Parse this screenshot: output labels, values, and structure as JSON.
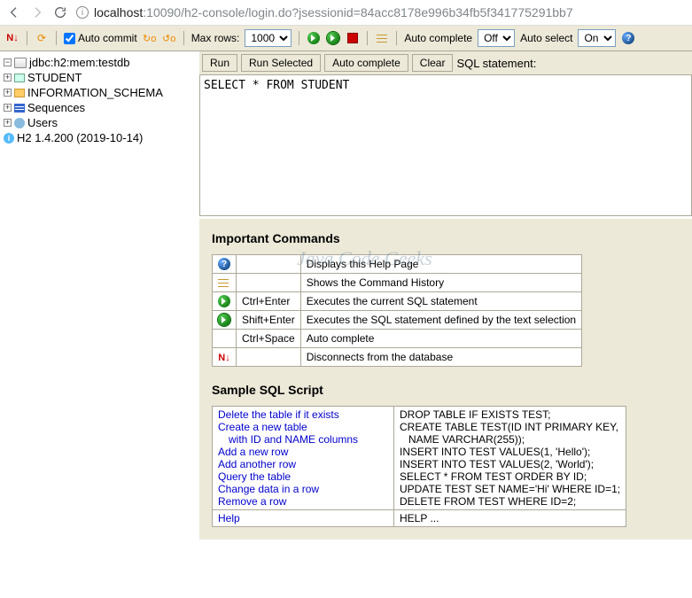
{
  "browser": {
    "url_host": "localhost",
    "url_rest": ":10090/h2-console/login.do?jsessionid=84acc8178e996b34fb5f341775291bb7"
  },
  "toolbar": {
    "auto_commit": "Auto commit",
    "max_rows": "Max rows:",
    "max_rows_value": "1000",
    "auto_complete": "Auto complete",
    "auto_complete_value": "Off",
    "auto_select": "Auto select",
    "auto_select_value": "On"
  },
  "tree": {
    "db": "jdbc:h2:mem:testdb",
    "student": "STUDENT",
    "info_schema": "INFORMATION_SCHEMA",
    "sequences": "Sequences",
    "users": "Users",
    "version": "H2 1.4.200 (2019-10-14)"
  },
  "sql": {
    "run": "Run",
    "run_selected": "Run Selected",
    "auto_complete": "Auto complete",
    "clear": "Clear",
    "label": "SQL statement:",
    "value": "SELECT * FROM STUDENT "
  },
  "commands": {
    "heading": "Important Commands",
    "rows": [
      {
        "key": "",
        "desc": "Displays this Help Page"
      },
      {
        "key": "",
        "desc": "Shows the Command History"
      },
      {
        "key": "Ctrl+Enter",
        "desc": "Executes the current SQL statement"
      },
      {
        "key": "Shift+Enter",
        "desc": "Executes the SQL statement defined by the text selection"
      },
      {
        "key": "Ctrl+Space",
        "desc": "Auto complete"
      },
      {
        "key": "",
        "desc": "Disconnects from the database"
      }
    ]
  },
  "script": {
    "heading": "Sample SQL Script",
    "rows": [
      {
        "label": "Delete the table if it exists",
        "sql": "DROP TABLE IF EXISTS TEST;"
      },
      {
        "label": "Create a new table",
        "sql": "CREATE TABLE TEST(ID INT PRIMARY KEY,"
      },
      {
        "label": "  with ID and NAME columns",
        "sql": "  NAME VARCHAR(255));",
        "indent": true
      },
      {
        "label": "Add a new row",
        "sql": "INSERT INTO TEST VALUES(1, 'Hello');"
      },
      {
        "label": "Add another row",
        "sql": "INSERT INTO TEST VALUES(2, 'World');"
      },
      {
        "label": "Query the table",
        "sql": "SELECT * FROM TEST ORDER BY ID;"
      },
      {
        "label": "Change data in a row",
        "sql": "UPDATE TEST SET NAME='Hi' WHERE ID=1;"
      },
      {
        "label": "Remove a row",
        "sql": "DELETE FROM TEST WHERE ID=2;"
      }
    ],
    "help_label": "Help",
    "help_sql": "HELP ..."
  },
  "watermark": "Java Code Geeks"
}
